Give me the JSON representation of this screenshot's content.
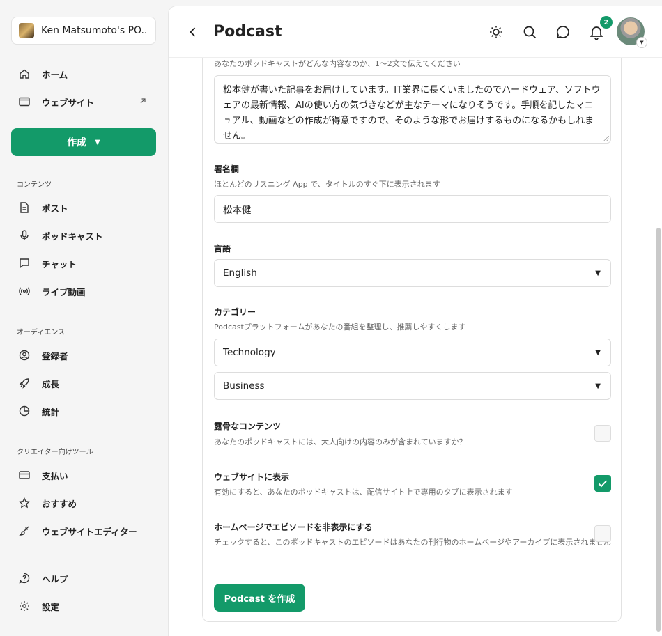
{
  "sidebar": {
    "publication_name": "Ken Matsumoto's PO...",
    "nav_primary": [
      {
        "label": "ホーム"
      },
      {
        "label": "ウェブサイト"
      }
    ],
    "create_label": "作成",
    "sections": [
      {
        "heading": "コンテンツ",
        "items": [
          "ポスト",
          "ポッドキャスト",
          "チャット",
          "ライブ動画"
        ]
      },
      {
        "heading": "オーディエンス",
        "items": [
          "登録者",
          "成長",
          "統計"
        ]
      },
      {
        "heading": "クリエイター向けツール",
        "items": [
          "支払い",
          "おすすめ",
          "ウェブサイトエディター"
        ]
      }
    ],
    "footer": [
      "ヘルプ",
      "設定"
    ]
  },
  "header": {
    "title": "Podcast",
    "notification_count": "2"
  },
  "form": {
    "description": {
      "hint": "あなたのポッドキャストがどんな内容なのか、1〜2文で伝えてください",
      "value": "松本健が書いた記事をお届けしています。IT業界に長くいましたのでハードウェア、ソフトウェアの最新情報、AIの使い方の気づきなどが主なテーマになりそうです。手順を記したマニュアル、動画などの作成が得意ですので、そのような形でお届けするものになるかもしれません。"
    },
    "byline": {
      "label": "署名欄",
      "hint": "ほとんどのリスニング App で、タイトルのすぐ下に表示されます",
      "value": "松本健"
    },
    "language": {
      "label": "言語",
      "value": "English"
    },
    "category": {
      "label": "カテゴリー",
      "hint": "Podcastプラットフォームがあなたの番組を整理し、推薦しやすくします",
      "primary": "Technology",
      "secondary": "Business"
    },
    "explicit": {
      "label": "露骨なコンテンツ",
      "hint": "あなたのポッドキャストには、大人向けの内容のみが含まれていますか？",
      "checked": false
    },
    "show_on_site": {
      "label": "ウェブサイトに表示",
      "hint": "有効にすると、あなたのポッドキャストは、配信サイト上で専用のタブに表示されます",
      "checked": true
    },
    "hide_episodes": {
      "label": "ホームページでエピソードを非表示にする",
      "hint": "チェックすると、このポッドキャストのエピソードはあなたの刊行物のホームページやアーカイブに表示されません",
      "checked": false
    },
    "submit_label": "Podcast を作成"
  },
  "colors": {
    "accent": "#139a69"
  }
}
